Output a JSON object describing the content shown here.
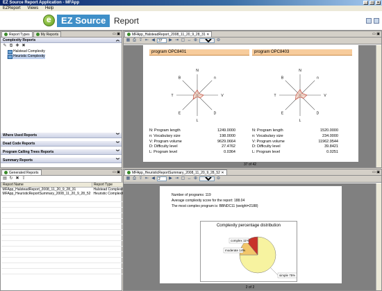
{
  "window": {
    "title": "EZ Source Report Application - MFApp"
  },
  "menu": [
    "EZReport",
    "Views",
    "Help"
  ],
  "banner": {
    "brand": "EZ Source",
    "title": "Report"
  },
  "left_top": {
    "tabs": [
      "Report Types",
      "My Reports"
    ],
    "section_open": "Complexity Reports",
    "tree": [
      "Halstead Complexity",
      "Heuristic Complexity"
    ],
    "sections_closed": [
      "Where Used Reports",
      "Dead Code Reports",
      "Program Calling Trees Reports",
      "Summary Reports"
    ]
  },
  "left_bottom": {
    "tab": "Generated Reports",
    "columns": [
      "Report Name",
      "Report Type"
    ],
    "rows": [
      {
        "name": "MFApp_HalsteadReport_2008_11_20_9_28_31",
        "type": "Halstead Complexity"
      },
      {
        "name": "MFApp_HeuristicReportSummary_2008_11_20_9_28_52",
        "type": "Heuristic Complexity"
      }
    ]
  },
  "top_viewer": {
    "tab": "MFApp_HalsteadReport_2008_11_20_9_28_31",
    "page": "37",
    "zoom": "125%",
    "page_info": "37 of 42",
    "programs": [
      {
        "title": "program OPC8401",
        "metrics": [
          {
            "label": "N: Program length",
            "value": "1249.0000"
          },
          {
            "label": "n: Vocabulary size",
            "value": "198.0000"
          },
          {
            "label": "V: Program volume",
            "value": "9629.0664"
          },
          {
            "label": "D: Difficulty level",
            "value": "27.4762"
          },
          {
            "label": "L: Program level",
            "value": "0.0364"
          }
        ]
      },
      {
        "title": "program OPC8403",
        "metrics": [
          {
            "label": "N: Program length",
            "value": "1520.0000"
          },
          {
            "label": "n: Vocabulary size",
            "value": "234.0000"
          },
          {
            "label": "V: Program volume",
            "value": "11962.9544"
          },
          {
            "label": "D: Difficulty level",
            "value": "39.8421"
          },
          {
            "label": "L: Program level",
            "value": "0.0251"
          }
        ]
      }
    ],
    "radar_labels": [
      "N",
      "n",
      "V",
      "D",
      "L",
      "E",
      "T",
      "B"
    ]
  },
  "bottom_viewer": {
    "tab": "MFApp_HeuristicReportSummary_2008_11_20_9_28_52",
    "page": "2",
    "zoom": "100%",
    "page_info": "2 of 2",
    "lines": [
      "Number of programs: 119",
      "Average complexity score for the report: 188.04",
      "The most complex program is: BBNDC11 (weight=2188)"
    ],
    "chart_title": "Complexity percentage distribution",
    "slices": [
      {
        "label": "simple 75%",
        "value": 75,
        "color": "#f7f3a0"
      },
      {
        "label": "moderate 14%",
        "value": 14,
        "color": "#f2c66a"
      },
      {
        "label": "complex 11%",
        "value": 11,
        "color": "#c8322a"
      }
    ]
  },
  "chart_data": {
    "type": "pie",
    "title": "Complexity percentage distribution",
    "categories": [
      "simple",
      "moderate",
      "complex"
    ],
    "values": [
      75,
      14,
      11
    ]
  }
}
